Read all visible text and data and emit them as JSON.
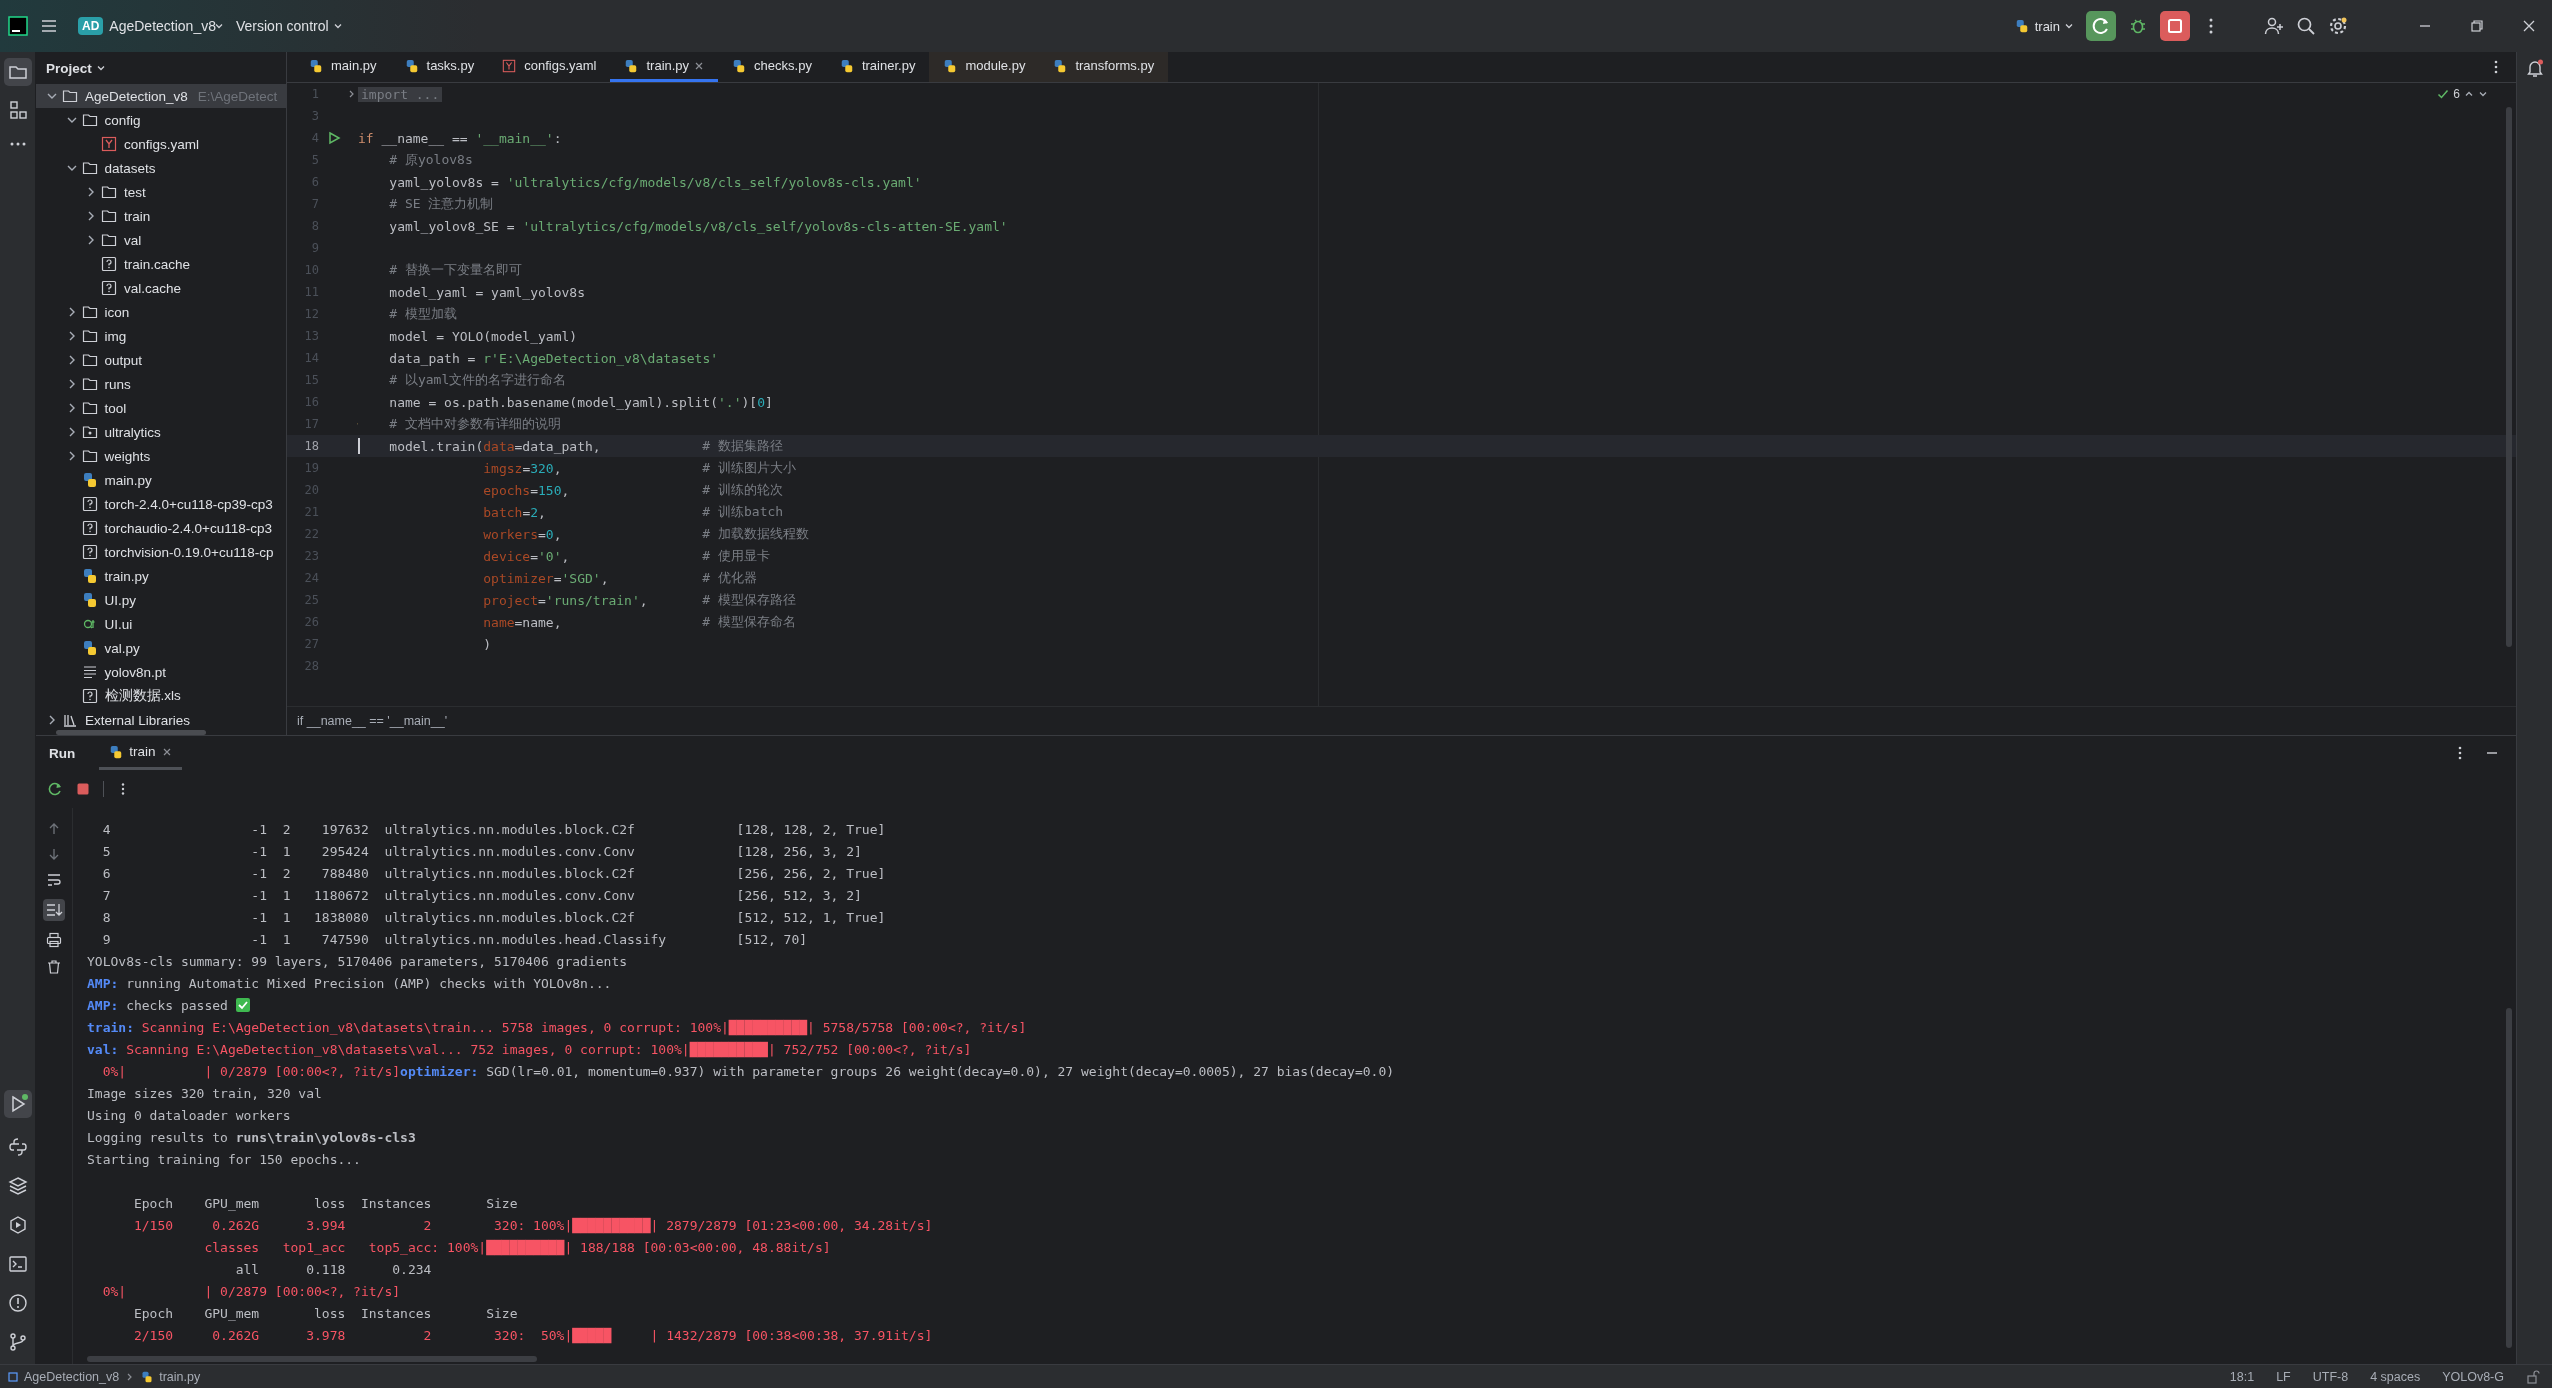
{
  "title_bar": {
    "app_badge": "AD",
    "project": "AgeDetection_v8",
    "vcs": "Version control",
    "run_config": "train"
  },
  "project_panel": {
    "title": "Project",
    "tree": [
      {
        "label": "AgeDetection_v8",
        "hint": "E:\\AgeDetect",
        "kind": "folder",
        "expanded": true,
        "selected": true,
        "children": [
          {
            "label": "config",
            "kind": "folder",
            "expanded": true,
            "selected": false,
            "children": [
              {
                "label": "configs.yaml",
                "kind": "yaml",
                "selected": false
              }
            ]
          },
          {
            "label": "datasets",
            "kind": "folder",
            "expanded": true,
            "selected": false,
            "children": [
              {
                "label": "test",
                "kind": "folder",
                "expanded": false,
                "selected": false
              },
              {
                "label": "train",
                "kind": "folder",
                "expanded": false,
                "selected": false
              },
              {
                "label": "val",
                "kind": "folder",
                "expanded": false,
                "selected": false
              },
              {
                "label": "train.cache",
                "kind": "unknown",
                "selected": false
              },
              {
                "label": "val.cache",
                "kind": "unknown",
                "selected": false
              }
            ]
          },
          {
            "label": "icon",
            "kind": "folder",
            "expanded": false,
            "selected": false
          },
          {
            "label": "img",
            "kind": "folder",
            "expanded": false,
            "selected": false
          },
          {
            "label": "output",
            "kind": "folder",
            "expanded": false,
            "selected": false
          },
          {
            "label": "runs",
            "kind": "folder",
            "expanded": false,
            "selected": false
          },
          {
            "label": "tool",
            "kind": "folder",
            "expanded": false,
            "selected": false
          },
          {
            "label": "ultralytics",
            "kind": "package",
            "expanded": false,
            "selected": false
          },
          {
            "label": "weights",
            "kind": "folder",
            "expanded": false,
            "selected": false
          },
          {
            "label": "main.py",
            "kind": "python",
            "selected": false
          },
          {
            "label": "torch-2.4.0+cu118-cp39-cp3",
            "kind": "unknown",
            "selected": false
          },
          {
            "label": "torchaudio-2.4.0+cu118-cp3",
            "kind": "unknown",
            "selected": false
          },
          {
            "label": "torchvision-0.19.0+cu118-cp",
            "kind": "unknown",
            "selected": false
          },
          {
            "label": "train.py",
            "kind": "python",
            "selected": false
          },
          {
            "label": "UI.py",
            "kind": "python",
            "selected": false
          },
          {
            "label": "UI.ui",
            "kind": "qt",
            "selected": false
          },
          {
            "label": "val.py",
            "kind": "python",
            "selected": false
          },
          {
            "label": "yolov8n.pt",
            "kind": "text",
            "selected": false
          },
          {
            "label": "检测数据.xls",
            "kind": "unknown",
            "selected": false
          }
        ]
      },
      {
        "label": "External Libraries",
        "kind": "library",
        "expanded": false,
        "selected": false
      }
    ]
  },
  "tabs": [
    {
      "label": "main.py",
      "kind": "python",
      "selected": false,
      "external": false
    },
    {
      "label": "tasks.py",
      "kind": "python",
      "selected": false,
      "external": false
    },
    {
      "label": "configs.yaml",
      "kind": "yaml",
      "selected": false,
      "external": false
    },
    {
      "label": "train.py",
      "kind": "python",
      "selected": true,
      "external": false
    },
    {
      "label": "checks.py",
      "kind": "python",
      "selected": false,
      "external": false
    },
    {
      "label": "trainer.py",
      "kind": "python",
      "selected": false,
      "external": false
    },
    {
      "label": "module.py",
      "kind": "python",
      "selected": false,
      "external": true
    },
    {
      "label": "transforms.py",
      "kind": "python",
      "selected": false,
      "external": true
    }
  ],
  "editor": {
    "problems": "6",
    "breadcrumb": "if __name__ == '__main__'",
    "lines": [
      {
        "n": "1",
        "current": false,
        "kind": "fold",
        "tokens": [
          {
            "kind": "fold",
            "t": "import ..."
          }
        ]
      },
      {
        "n": "3",
        "current": false
      },
      {
        "n": "4",
        "current": false,
        "kind": "run",
        "tokens": [
          {
            "kind": "kw",
            "t": "if"
          },
          {
            "kind": "plain",
            "t": " __name__ == "
          },
          {
            "kind": "str",
            "t": "'__main__'"
          },
          {
            "kind": "plain",
            "t": ":"
          }
        ]
      },
      {
        "n": "5",
        "current": false,
        "tokens": [
          {
            "kind": "cmt",
            "t": "    # 原yolov8s"
          }
        ]
      },
      {
        "n": "6",
        "current": false,
        "tokens": [
          {
            "kind": "plain",
            "t": "    yaml_yolov8s = "
          },
          {
            "kind": "str",
            "t": "'ultralytics/cfg/models/v8/cls_self/yolov8s-cls.yaml'"
          }
        ]
      },
      {
        "n": "7",
        "current": false,
        "tokens": [
          {
            "kind": "cmt",
            "t": "    # SE 注意力机制"
          }
        ]
      },
      {
        "n": "8",
        "current": false,
        "tokens": [
          {
            "kind": "plain",
            "t": "    yaml_yolov8_SE = "
          },
          {
            "kind": "str",
            "t": "'ultralytics/cfg/models/v8/cls_self/yolov8s-cls-atten-SE.yaml'"
          }
        ]
      },
      {
        "n": "9",
        "current": false
      },
      {
        "n": "10",
        "current": false,
        "tokens": [
          {
            "kind": "cmt",
            "t": "    # 替换一下变量名即可"
          }
        ]
      },
      {
        "n": "11",
        "current": false,
        "tokens": [
          {
            "kind": "plain",
            "t": "    model_yaml = yaml_yolov8s"
          }
        ]
      },
      {
        "n": "12",
        "current": false,
        "tokens": [
          {
            "kind": "cmt",
            "t": "    # 模型加载"
          }
        ]
      },
      {
        "n": "13",
        "current": false,
        "tokens": [
          {
            "kind": "plain",
            "t": "    model = YOLO(model_yaml)"
          }
        ]
      },
      {
        "n": "14",
        "current": false,
        "tokens": [
          {
            "kind": "plain",
            "t": "    data_path = "
          },
          {
            "kind": "str",
            "t": "r'E:\\AgeDetection_v8\\datasets'"
          }
        ]
      },
      {
        "n": "15",
        "current": false,
        "tokens": [
          {
            "kind": "cmt",
            "t": "    # 以yaml文件的名字进行命名"
          }
        ]
      },
      {
        "n": "16",
        "current": false,
        "tokens": [
          {
            "kind": "plain",
            "t": "    name = os.path.basename(model_yaml).split("
          },
          {
            "kind": "str",
            "t": "'.'"
          },
          {
            "kind": "plain",
            "t": ")["
          },
          {
            "kind": "num",
            "t": "0"
          },
          {
            "kind": "plain",
            "t": "]"
          }
        ]
      },
      {
        "n": "17",
        "current": false,
        "kind": "bulb",
        "tokens": [
          {
            "kind": "cmt",
            "t": "    # 文档中对参数有详细的说明"
          }
        ]
      },
      {
        "n": "18",
        "current": true,
        "tokens": [
          {
            "kind": "plain",
            "t": "    model.train("
          },
          {
            "kind": "param",
            "t": "data"
          },
          {
            "kind": "plain",
            "t": "=data_path,"
          }
        ],
        "note": "# 数据集路径"
      },
      {
        "n": "19",
        "current": false,
        "tokens": [
          {
            "kind": "param",
            "t": "                imgsz"
          },
          {
            "kind": "plain",
            "t": "="
          },
          {
            "kind": "num",
            "t": "320"
          },
          {
            "kind": "plain",
            "t": ","
          }
        ],
        "note": "# 训练图片大小"
      },
      {
        "n": "20",
        "current": false,
        "tokens": [
          {
            "kind": "param",
            "t": "                epochs"
          },
          {
            "kind": "plain",
            "t": "="
          },
          {
            "kind": "num",
            "t": "150"
          },
          {
            "kind": "plain",
            "t": ","
          }
        ],
        "note": "# 训练的轮次"
      },
      {
        "n": "21",
        "current": false,
        "tokens": [
          {
            "kind": "param",
            "t": "                batch"
          },
          {
            "kind": "plain",
            "t": "="
          },
          {
            "kind": "num",
            "t": "2"
          },
          {
            "kind": "plain",
            "t": ","
          }
        ],
        "note": "# 训练batch"
      },
      {
        "n": "22",
        "current": false,
        "tokens": [
          {
            "kind": "param",
            "t": "                workers"
          },
          {
            "kind": "plain",
            "t": "="
          },
          {
            "kind": "num",
            "t": "0"
          },
          {
            "kind": "plain",
            "t": ","
          }
        ],
        "note": "# 加载数据线程数"
      },
      {
        "n": "23",
        "current": false,
        "tokens": [
          {
            "kind": "param",
            "t": "                device"
          },
          {
            "kind": "plain",
            "t": "="
          },
          {
            "kind": "str",
            "t": "'0'"
          },
          {
            "kind": "plain",
            "t": ","
          }
        ],
        "note": "# 使用显卡"
      },
      {
        "n": "24",
        "current": false,
        "tokens": [
          {
            "kind": "param",
            "t": "                optimizer"
          },
          {
            "kind": "plain",
            "t": "="
          },
          {
            "kind": "str",
            "t": "'SGD'"
          },
          {
            "kind": "plain",
            "t": ","
          }
        ],
        "note": "# 优化器"
      },
      {
        "n": "25",
        "current": false,
        "tokens": [
          {
            "kind": "param",
            "t": "                project"
          },
          {
            "kind": "plain",
            "t": "="
          },
          {
            "kind": "str",
            "t": "'runs/train'"
          },
          {
            "kind": "plain",
            "t": ","
          }
        ],
        "note": "# 模型保存路径"
      },
      {
        "n": "26",
        "current": false,
        "tokens": [
          {
            "kind": "param",
            "t": "                name"
          },
          {
            "kind": "plain",
            "t": "=name,"
          }
        ],
        "note": "# 模型保存命名"
      },
      {
        "n": "27",
        "current": false,
        "tokens": [
          {
            "kind": "plain",
            "t": "                )"
          }
        ]
      },
      {
        "n": "28",
        "current": false
      }
    ]
  },
  "run_panel": {
    "title": "Run",
    "tab": "train",
    "console": [
      {
        "segs": [
          {
            "kind": "plain",
            "t": "  4                  -1  2    197632  ultralytics.nn.modules.block.C2f             [128, 128, 2, True]"
          }
        ]
      },
      {
        "segs": [
          {
            "kind": "plain",
            "t": "  5                  -1  1    295424  ultralytics.nn.modules.conv.Conv             [128, 256, 3, 2]"
          }
        ]
      },
      {
        "segs": [
          {
            "kind": "plain",
            "t": "  6                  -1  2    788480  ultralytics.nn.modules.block.C2f             [256, 256, 2, True]"
          }
        ]
      },
      {
        "segs": [
          {
            "kind": "plain",
            "t": "  7                  -1  1   1180672  ultralytics.nn.modules.conv.Conv             [256, 512, 3, 2]"
          }
        ]
      },
      {
        "segs": [
          {
            "kind": "plain",
            "t": "  8                  -1  1   1838080  ultralytics.nn.modules.block.C2f             [512, 512, 1, True]"
          }
        ]
      },
      {
        "segs": [
          {
            "kind": "plain",
            "t": "  9                  -1  1    747590  ultralytics.nn.modules.head.Classify         [512, 70]"
          }
        ]
      },
      {
        "segs": [
          {
            "kind": "plain",
            "t": "YOLOv8s-cls summary: 99 layers, 5170406 parameters, 5170406 gradients"
          }
        ]
      },
      {
        "segs": [
          {
            "kind": "label",
            "t": "AMP:"
          },
          {
            "kind": "plain",
            "t": " running Automatic Mixed Precision (AMP) checks with YOLOv8n..."
          }
        ]
      },
      {
        "segs": [
          {
            "kind": "label",
            "t": "AMP:"
          },
          {
            "kind": "plain",
            "t": " checks passed "
          },
          {
            "kind": "check"
          }
        ]
      },
      {
        "segs": [
          {
            "kind": "label",
            "t": "train:"
          },
          {
            "kind": "red",
            "t": " Scanning E:\\AgeDetection_v8\\datasets\\train... 5758 images, 0 corrupt: 100%|██████████| 5758/5758 [00:00<?, ?it/s]"
          }
        ]
      },
      {
        "segs": [
          {
            "kind": "label",
            "t": "val:"
          },
          {
            "kind": "red",
            "t": " Scanning E:\\AgeDetection_v8\\datasets\\val... 752 images, 0 corrupt: 100%|██████████| 752/752 [00:00<?, ?it/s]"
          }
        ]
      },
      {
        "segs": [
          {
            "kind": "red",
            "t": "  0%|          | 0/2879 [00:00<?, ?it/s]"
          },
          {
            "kind": "label",
            "t": "optimizer:"
          },
          {
            "kind": "plain",
            "t": " SGD(lr=0.01, momentum=0.937) with parameter groups 26 weight(decay=0.0), 27 weight(decay=0.0005), 27 bias(decay=0.0)"
          }
        ]
      },
      {
        "segs": [
          {
            "kind": "plain",
            "t": "Image sizes 320 train, 320 val"
          }
        ]
      },
      {
        "segs": [
          {
            "kind": "plain",
            "t": "Using 0 dataloader workers"
          }
        ]
      },
      {
        "segs": [
          {
            "kind": "plain",
            "t": "Logging results to "
          },
          {
            "kind": "bold",
            "t": "runs\\train\\yolov8s-cls3"
          }
        ]
      },
      {
        "segs": [
          {
            "kind": "plain",
            "t": "Starting training for 150 epochs..."
          }
        ]
      },
      {
        "gap": true,
        "segs": [
          {
            "kind": "plain",
            "t": "      Epoch    GPU_mem       loss  Instances       Size"
          }
        ]
      },
      {
        "segs": [
          {
            "kind": "red",
            "t": "      1/150     0.262G      3.994          2        320: 100%|██████████| 2879/2879 [01:23<00:00, 34.28it/s]"
          }
        ]
      },
      {
        "segs": [
          {
            "kind": "red",
            "t": "               classes   top1_acc   top5_acc: 100%|██████████| 188/188 [00:03<00:00, 48.88it/s]"
          }
        ]
      },
      {
        "segs": [
          {
            "kind": "plain",
            "t": "                   all      0.118      0.234"
          }
        ]
      },
      {
        "segs": [
          {
            "kind": "red",
            "t": "  0%|          | 0/2879 [00:00<?, ?it/s]"
          }
        ]
      },
      {
        "segs": [
          {
            "kind": "plain",
            "t": "      Epoch    GPU_mem       loss  Instances       Size"
          }
        ]
      },
      {
        "segs": [
          {
            "kind": "red",
            "t": "      2/150     0.262G      3.978          2        320:  50%|█████     | 1432/2879 [00:38<00:38, 37.91it/s]"
          }
        ]
      }
    ]
  },
  "status_bar": {
    "path": [
      "AgeDetection_v8",
      "train.py"
    ],
    "items": [
      "18:1",
      "LF",
      "UTF-8",
      "4 spaces",
      "YOLOv8-G"
    ]
  }
}
